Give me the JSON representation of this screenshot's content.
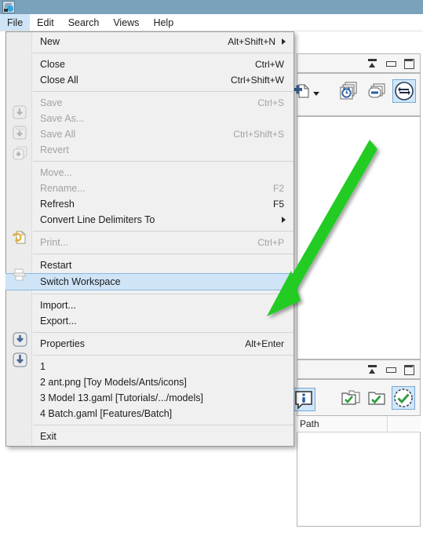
{
  "window": {
    "app_icon": "gama-app-icon"
  },
  "menubar": {
    "items": [
      {
        "label": "File",
        "active": true
      },
      {
        "label": "Edit",
        "active": false
      },
      {
        "label": "Search",
        "active": false
      },
      {
        "label": "Views",
        "active": false
      },
      {
        "label": "Help",
        "active": false
      }
    ]
  },
  "file_menu": {
    "groups": [
      {
        "items": [
          {
            "label": "New",
            "accel": "Alt+Shift+N",
            "submenu": true,
            "disabled": false,
            "icon": null,
            "highlight": false
          }
        ]
      },
      {
        "items": [
          {
            "label": "Close",
            "accel": "Ctrl+W",
            "submenu": false,
            "disabled": false,
            "icon": null,
            "highlight": false
          },
          {
            "label": "Close All",
            "accel": "Ctrl+Shift+W",
            "submenu": false,
            "disabled": false,
            "icon": null,
            "highlight": false
          }
        ]
      },
      {
        "items": [
          {
            "label": "Save",
            "accel": "Ctrl+S",
            "submenu": false,
            "disabled": true,
            "icon": "save-icon",
            "highlight": false
          },
          {
            "label": "Save As...",
            "accel": "",
            "submenu": false,
            "disabled": true,
            "icon": "save-as-icon",
            "highlight": false
          },
          {
            "label": "Save All",
            "accel": "Ctrl+Shift+S",
            "submenu": false,
            "disabled": true,
            "icon": "save-all-icon",
            "highlight": false
          },
          {
            "label": "Revert",
            "accel": "",
            "submenu": false,
            "disabled": true,
            "icon": null,
            "highlight": false
          }
        ]
      },
      {
        "items": [
          {
            "label": "Move...",
            "accel": "",
            "submenu": false,
            "disabled": true,
            "icon": null,
            "highlight": false
          },
          {
            "label": "Rename...",
            "accel": "F2",
            "submenu": false,
            "disabled": true,
            "icon": null,
            "highlight": false
          },
          {
            "label": "Refresh",
            "accel": "F5",
            "submenu": false,
            "disabled": false,
            "icon": "refresh-icon",
            "highlight": false
          },
          {
            "label": "Convert Line Delimiters To",
            "accel": "",
            "submenu": true,
            "disabled": false,
            "icon": null,
            "highlight": false
          }
        ]
      },
      {
        "items": [
          {
            "label": "Print...",
            "accel": "Ctrl+P",
            "submenu": false,
            "disabled": true,
            "icon": "print-icon",
            "highlight": false
          }
        ]
      },
      {
        "items": [
          {
            "label": "Restart",
            "accel": "",
            "submenu": false,
            "disabled": false,
            "icon": null,
            "highlight": false
          },
          {
            "label": "Switch Workspace",
            "accel": "",
            "submenu": false,
            "disabled": false,
            "icon": null,
            "highlight": true
          }
        ]
      },
      {
        "items": [
          {
            "label": "Import...",
            "accel": "",
            "submenu": false,
            "disabled": false,
            "icon": "import-icon",
            "highlight": false
          },
          {
            "label": "Export...",
            "accel": "",
            "submenu": false,
            "disabled": false,
            "icon": "export-icon",
            "highlight": false
          }
        ]
      },
      {
        "items": [
          {
            "label": "Properties",
            "accel": "Alt+Enter",
            "submenu": false,
            "disabled": false,
            "icon": null,
            "highlight": false
          }
        ]
      },
      {
        "items": [
          {
            "label": "1",
            "accel": "",
            "submenu": false,
            "disabled": false,
            "icon": null,
            "highlight": false
          },
          {
            "label": "2 ant.png  [Toy Models/Ants/icons]",
            "accel": "",
            "submenu": false,
            "disabled": false,
            "icon": null,
            "highlight": false
          },
          {
            "label": "3 Model 13.gaml  [Tutorials/.../models]",
            "accel": "",
            "submenu": false,
            "disabled": false,
            "icon": null,
            "highlight": false
          },
          {
            "label": "4 Batch.gaml  [Features/Batch]",
            "accel": "",
            "submenu": false,
            "disabled": false,
            "icon": null,
            "highlight": false
          }
        ]
      },
      {
        "items": [
          {
            "label": "Exit",
            "accel": "",
            "submenu": false,
            "disabled": false,
            "icon": null,
            "highlight": false
          }
        ]
      }
    ]
  },
  "top_panel": {
    "view_buttons": [
      "restore-view-icon",
      "minimize-view-icon",
      "maximize-view-icon"
    ],
    "toolbar_icons": [
      "new-file-icon",
      "dropdown-arrow-icon",
      "alarm-clock-stack-icon",
      "minus-stack-icon",
      "sync-arrows-icon"
    ]
  },
  "bottom_panel": {
    "view_buttons": [
      "restore-view-icon",
      "minimize-view-icon",
      "maximize-view-icon"
    ],
    "toolbar_icons": [
      "info-bubble-icon",
      "folder-check-stack-icon",
      "folder-check-icon",
      "circle-check-icon"
    ],
    "column_header": "Path"
  },
  "annotation": {
    "arrow_color": "#22cc22",
    "arrow_name": "green-pointer-arrow"
  }
}
